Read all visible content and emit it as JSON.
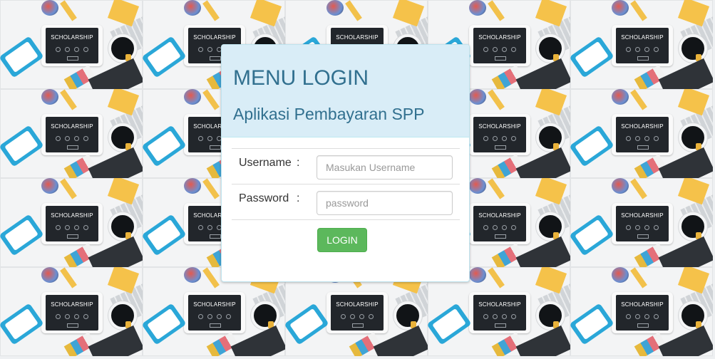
{
  "background": {
    "tile_label": "SCHOLARSHIP",
    "tile_count": 20
  },
  "login": {
    "title": "MENU LOGIN",
    "subtitle": "Aplikasi Pembayaran SPP",
    "username_label": "Username",
    "username_colon": ":",
    "username_placeholder": "Masukan Username",
    "username_value": "",
    "password_label": "Password",
    "password_colon": ":",
    "password_placeholder": "password",
    "password_value": "",
    "login_button_label": "LOGIN"
  },
  "colors": {
    "heading_bg": "#d9edf7",
    "heading_text": "#31708f",
    "button_bg": "#5cb85c"
  }
}
